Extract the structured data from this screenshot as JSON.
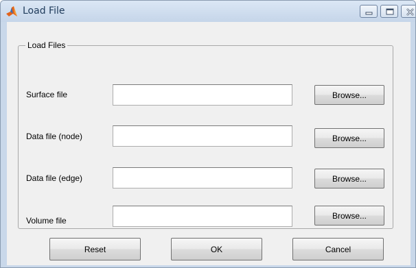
{
  "window": {
    "title": "Load File",
    "app_icon": "matlab-icon",
    "controls": [
      "minimize-icon",
      "maximize-icon",
      "close-icon"
    ]
  },
  "group": {
    "legend": "Load Files"
  },
  "rows": [
    {
      "label": "Surface file",
      "value": "",
      "button": "Browse..."
    },
    {
      "label": "Data file (node)",
      "value": "",
      "button": "Browse..."
    },
    {
      "label": "Data file (edge)",
      "value": "",
      "button": "Browse..."
    },
    {
      "label": "Volume file",
      "value": "",
      "button": "Browse..."
    }
  ],
  "actions": {
    "reset": "Reset",
    "ok": "OK",
    "cancel": "Cancel"
  },
  "colors": {
    "titlebar": "#c5d5e9",
    "client_background": "#f0f0f0"
  }
}
